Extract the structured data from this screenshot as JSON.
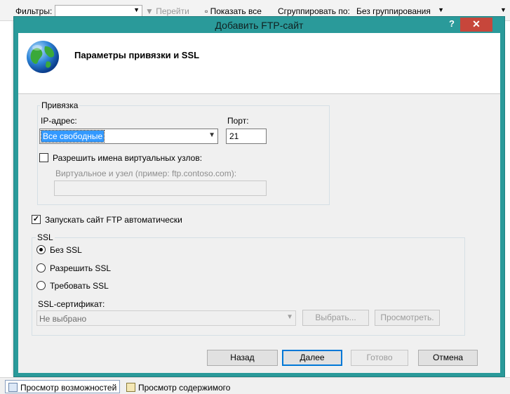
{
  "background": {
    "filters_label": "Фильтры:",
    "go_label": "Перейти",
    "show_all_label": "Показать все",
    "group_by_label": "Сгруппировать по:",
    "group_by_value": "Без группирования",
    "tab_features": "Просмотр возможностей",
    "tab_content": "Просмотр содержимого"
  },
  "dialog": {
    "title": "Добавить FTP-сайт",
    "help": "?",
    "close": "✕",
    "header": "Параметры привязки и SSL",
    "binding": {
      "group_label": "Привязка",
      "ip_label": "IP-адрес:",
      "ip_value": "Все свободные",
      "port_label": "Порт:",
      "port_value": "21",
      "allow_virtual_hosts_label": "Разрешить имена виртуальных узлов:",
      "allow_virtual_hosts_checked": false,
      "virtual_host_label": "Виртуальное и узел (пример: ftp.contoso.com):",
      "virtual_host_value": ""
    },
    "autostart": {
      "label": "Запускать сайт FTP автоматически",
      "checked": true
    },
    "ssl": {
      "group_label": "SSL",
      "options": [
        "Без SSL",
        "Разрешить SSL",
        "Требовать SSL"
      ],
      "selected": "Без SSL",
      "cert_label": "SSL-сертификат:",
      "cert_value": "Не выбрано",
      "select_button": "Выбрать...",
      "view_button": "Просмотреть."
    },
    "buttons": {
      "back": "Назад",
      "next": "Далее",
      "finish": "Готово",
      "cancel": "Отмена"
    }
  }
}
